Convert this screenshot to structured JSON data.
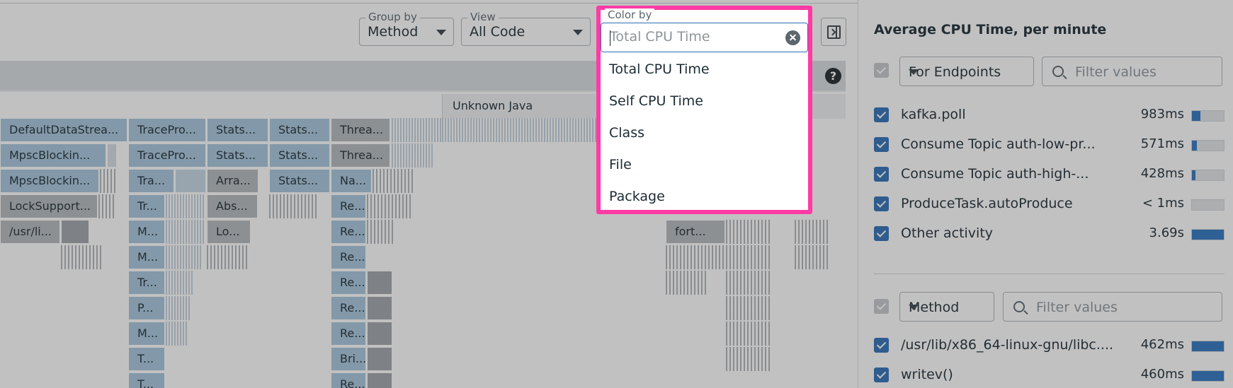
{
  "toolbar": {
    "group_by": {
      "label": "Group by",
      "value": "Method"
    },
    "view": {
      "label": "View",
      "value": "All Code"
    },
    "color_by": {
      "label": "Color by",
      "placeholder": "Total CPU Time",
      "options": [
        "Total CPU Time",
        "Self CPU Time",
        "Class",
        "File",
        "Package"
      ]
    }
  },
  "flame": {
    "help": "?",
    "unknown_java": "Unknown Java",
    "frames": [
      "DefaultDataStrea...",
      "TracePro...",
      "Stats...",
      "Stats...",
      "Threa...",
      "MpscBlockin...",
      "TracePro...",
      "Stats...",
      "Stats...",
      "Threa...",
      "MpscBlockin...",
      "Tra...",
      "Arra...",
      "Stats...",
      "Na...",
      "LockSupport...",
      "Tr...",
      "Abs...",
      "Re...",
      "/usr/li...",
      "M...",
      "Lo...",
      "Re...",
      "fort...",
      "M...",
      "Re...",
      "Tr...",
      "Re...",
      "P...",
      "Re...",
      "M...",
      "Re...",
      "T...",
      "Bri...",
      "T...",
      "Re..."
    ]
  },
  "panel": {
    "title": "Average CPU Time, per minute",
    "endpoints": {
      "dropdown": "For Endpoints",
      "filter_placeholder": "Filter values",
      "items": [
        {
          "name": "kafka.poll",
          "value": "983ms",
          "fill": 0.26
        },
        {
          "name": "Consume Topic auth-low-pr...",
          "value": "571ms",
          "fill": 0.15
        },
        {
          "name": "Consume Topic auth-high-...",
          "value": "428ms",
          "fill": 0.11
        },
        {
          "name": "ProduceTask.autoProduce",
          "value": "< 1ms",
          "fill": 0.0
        },
        {
          "name": "Other activity",
          "value": "3.69s",
          "fill": 1.0
        }
      ]
    },
    "methods": {
      "dropdown": "Method",
      "filter_placeholder": "Filter values",
      "items": [
        {
          "name": "/usr/lib/x86_64-linux-gnu/libc....",
          "value": "462ms",
          "fill": 1.0
        },
        {
          "name": "writev()",
          "value": "460ms",
          "fill": 1.0
        }
      ]
    }
  },
  "colors": {
    "accent": "#2f6fb7",
    "highlight": "#ff3aa5",
    "overlay": "#323232"
  }
}
